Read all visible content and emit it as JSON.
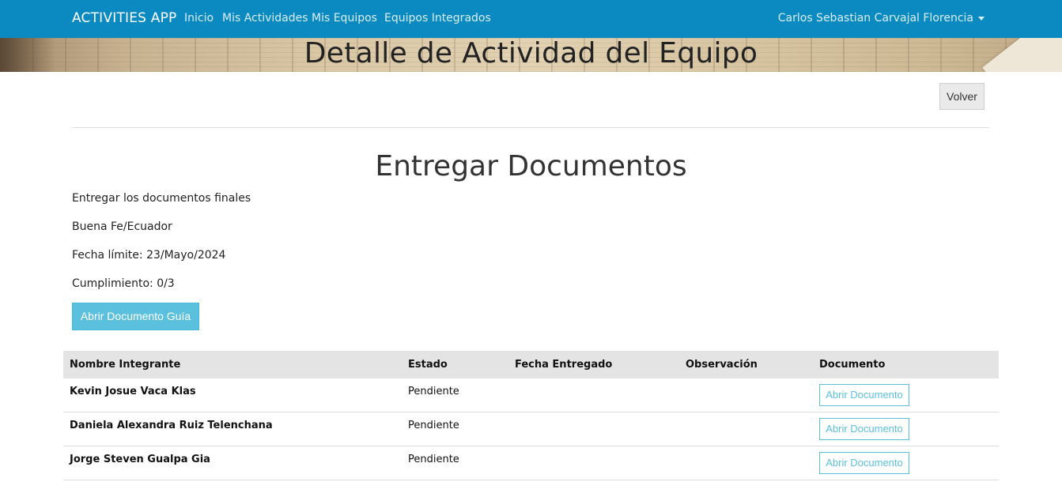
{
  "navbar": {
    "brand": "ACTIVITIES APP",
    "links": [
      "Inicio",
      "Mis Actividades",
      "Mis Equipos",
      "Equipos Integrados"
    ],
    "user": "Carlos Sebastian Carvajal Florencia"
  },
  "hero": {
    "title": "Detalle de Actividad del Equipo"
  },
  "actions": {
    "back_label": "Volver"
  },
  "activity": {
    "title": "Entregar Documentos",
    "description": "Entregar los documentos finales",
    "location": "Buena Fe/Ecuador",
    "deadline": "Fecha límite: 23/Mayo/2024",
    "completion": "Cumplimiento: 0/3",
    "guide_button": "Abrir Documento Guía"
  },
  "table": {
    "headers": [
      "Nombre Integrante",
      "Estado",
      "Fecha Entregado",
      "Observación",
      "Documento"
    ],
    "rows": [
      {
        "name": "Kevin Josue Vaca Klas",
        "status": "Pendiente",
        "date": "",
        "observation": "",
        "doc_button": "Abrir Documento"
      },
      {
        "name": "Daniela Alexandra Ruiz Telenchana",
        "status": "Pendiente",
        "date": "",
        "observation": "",
        "doc_button": "Abrir Documento"
      },
      {
        "name": "Jorge Steven Gualpa Gia",
        "status": "Pendiente",
        "date": "",
        "observation": "",
        "doc_button": "Abrir Documento"
      }
    ]
  },
  "colors": {
    "navbar": "#0a8ac0",
    "info_button": "#5bc0de"
  }
}
